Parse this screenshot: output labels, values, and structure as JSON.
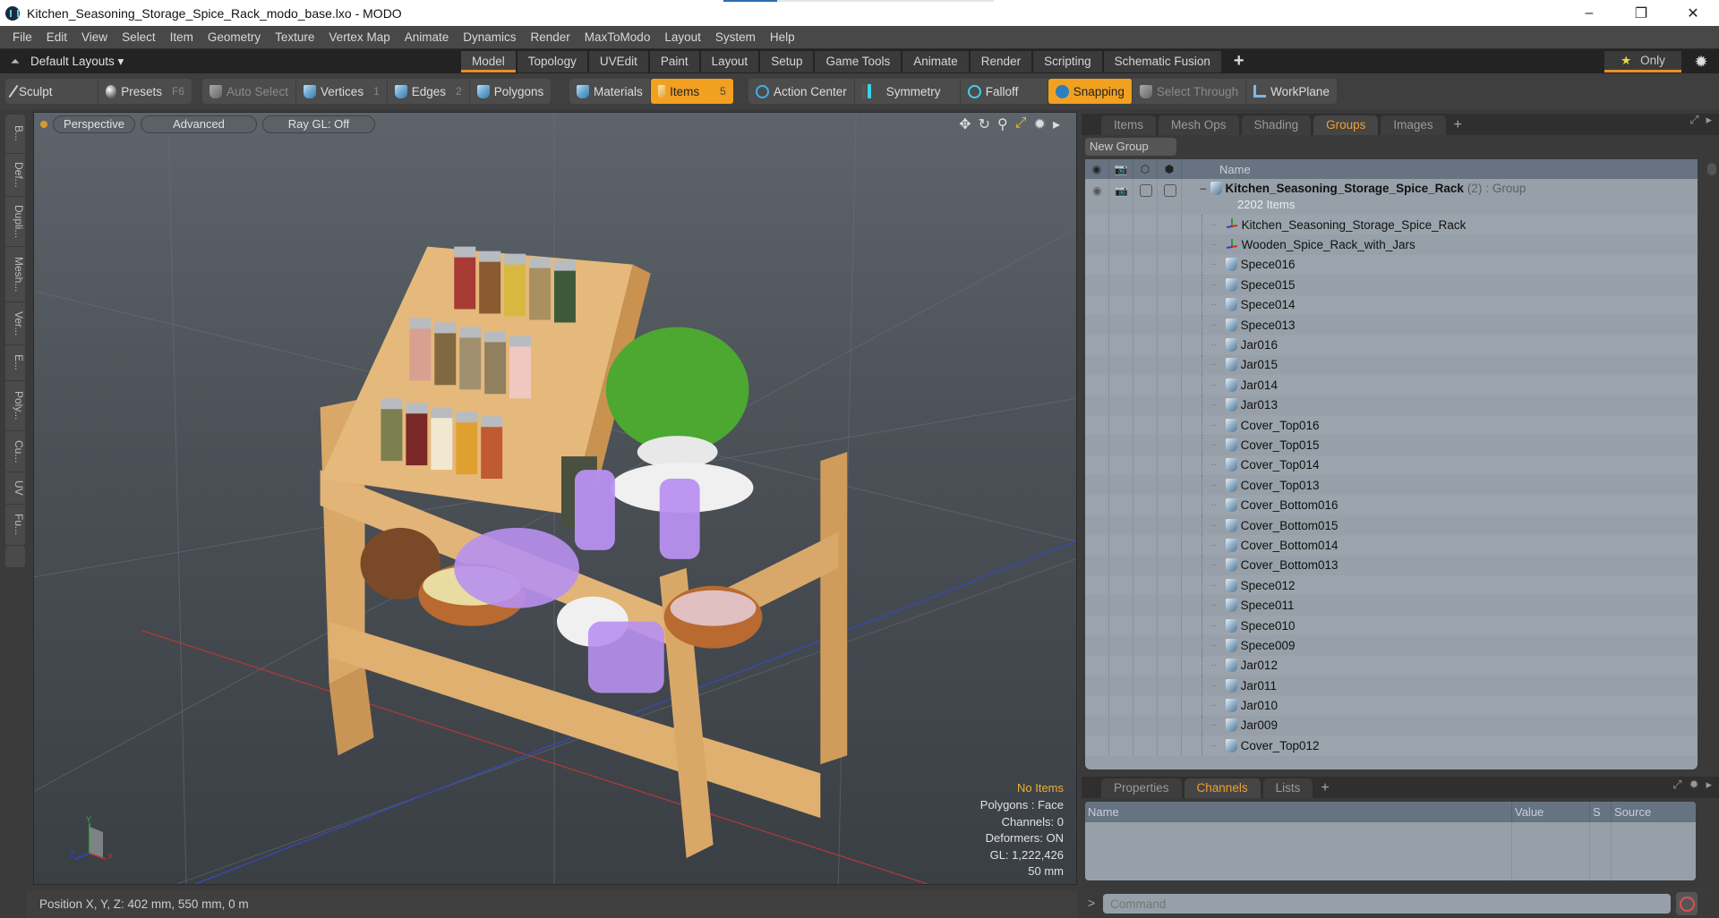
{
  "window": {
    "title": "Kitchen_Seasoning_Storage_Spice_Rack_modo_base.lxo - MODO",
    "minimize": "–",
    "maximize": "❐",
    "close": "✕"
  },
  "menu": [
    "File",
    "Edit",
    "View",
    "Select",
    "Item",
    "Geometry",
    "Texture",
    "Vertex Map",
    "Animate",
    "Dynamics",
    "Render",
    "MaxToModo",
    "Layout",
    "System",
    "Help"
  ],
  "layouts": {
    "dropdown": "Default Layouts ▾",
    "tabs": [
      "Model",
      "Topology",
      "UVEdit",
      "Paint",
      "Layout",
      "Setup",
      "Game Tools",
      "Animate",
      "Render",
      "Scripting",
      "Schematic Fusion"
    ],
    "active_tab": "Model",
    "add": "+",
    "only_label": "Only"
  },
  "toolbar": {
    "sculpt": "Sculpt",
    "presets": "Presets",
    "presets_key": "F6",
    "auto_select": "Auto Select",
    "vertices": "Vertices",
    "vertices_key": "1",
    "edges": "Edges",
    "edges_key": "2",
    "polygons": "Polygons",
    "materials": "Materials",
    "items": "Items",
    "items_key": "5",
    "action_center": "Action Center",
    "symmetry": "Symmetry",
    "falloff": "Falloff",
    "snapping": "Snapping",
    "select_through": "Select Through",
    "workplane": "WorkPlane",
    "accent": "#f2a020"
  },
  "left_tabs": [
    "B...",
    "Def...",
    "Dupli...",
    "Mesh...",
    "Ver...",
    "E...",
    "Poly...",
    "Cu...",
    "UV",
    "Fu..."
  ],
  "viewport": {
    "view": "Perspective",
    "shading": "Advanced",
    "raygl": "Ray GL: Off",
    "info": {
      "selection": "No Items",
      "polygons": "Polygons : Face",
      "channels": "Channels: 0",
      "deformers": "Deformers: ON",
      "gl": "GL: 1,222,426",
      "scale": "50 mm"
    },
    "axis": {
      "y": "Y",
      "z": "Z",
      "x": "X"
    }
  },
  "status": {
    "position": "Position X, Y, Z:   402 mm, 550 mm, 0 m"
  },
  "groups_panel": {
    "tabs": [
      "Items",
      "Mesh Ops",
      "Shading",
      "Groups",
      "Images"
    ],
    "active_tab": "Groups",
    "new_group": "New Group",
    "column_name": "Name",
    "root": {
      "name": "Kitchen_Seasoning_Storage_Spice_Rack",
      "count": "(2)",
      "type": ": Group",
      "sub": "2202 Items"
    },
    "rows": [
      {
        "name": "Kitchen_Seasoning_Storage_Spice_Rack",
        "icon": "locator"
      },
      {
        "name": "Wooden_Spice_Rack_with_Jars",
        "icon": "locator"
      },
      {
        "name": "Spece016",
        "icon": "mesh"
      },
      {
        "name": "Spece015",
        "icon": "mesh"
      },
      {
        "name": "Spece014",
        "icon": "mesh"
      },
      {
        "name": "Spece013",
        "icon": "mesh"
      },
      {
        "name": "Jar016",
        "icon": "mesh"
      },
      {
        "name": "Jar015",
        "icon": "mesh"
      },
      {
        "name": "Jar014",
        "icon": "mesh"
      },
      {
        "name": "Jar013",
        "icon": "mesh"
      },
      {
        "name": "Cover_Top016",
        "icon": "mesh"
      },
      {
        "name": "Cover_Top015",
        "icon": "mesh"
      },
      {
        "name": "Cover_Top014",
        "icon": "mesh"
      },
      {
        "name": "Cover_Top013",
        "icon": "mesh"
      },
      {
        "name": "Cover_Bottom016",
        "icon": "mesh"
      },
      {
        "name": "Cover_Bottom015",
        "icon": "mesh"
      },
      {
        "name": "Cover_Bottom014",
        "icon": "mesh"
      },
      {
        "name": "Cover_Bottom013",
        "icon": "mesh"
      },
      {
        "name": "Spece012",
        "icon": "mesh"
      },
      {
        "name": "Spece011",
        "icon": "mesh"
      },
      {
        "name": "Spece010",
        "icon": "mesh"
      },
      {
        "name": "Spece009",
        "icon": "mesh"
      },
      {
        "name": "Jar012",
        "icon": "mesh"
      },
      {
        "name": "Jar011",
        "icon": "mesh"
      },
      {
        "name": "Jar010",
        "icon": "mesh"
      },
      {
        "name": "Jar009",
        "icon": "mesh"
      },
      {
        "name": "Cover_Top012",
        "icon": "mesh"
      }
    ]
  },
  "channels_panel": {
    "tabs": [
      "Properties",
      "Channels",
      "Lists"
    ],
    "active_tab": "Channels",
    "columns": [
      "Name",
      "Value",
      "S",
      "Source"
    ]
  },
  "command": {
    "prompt": ">",
    "placeholder": "Command"
  }
}
